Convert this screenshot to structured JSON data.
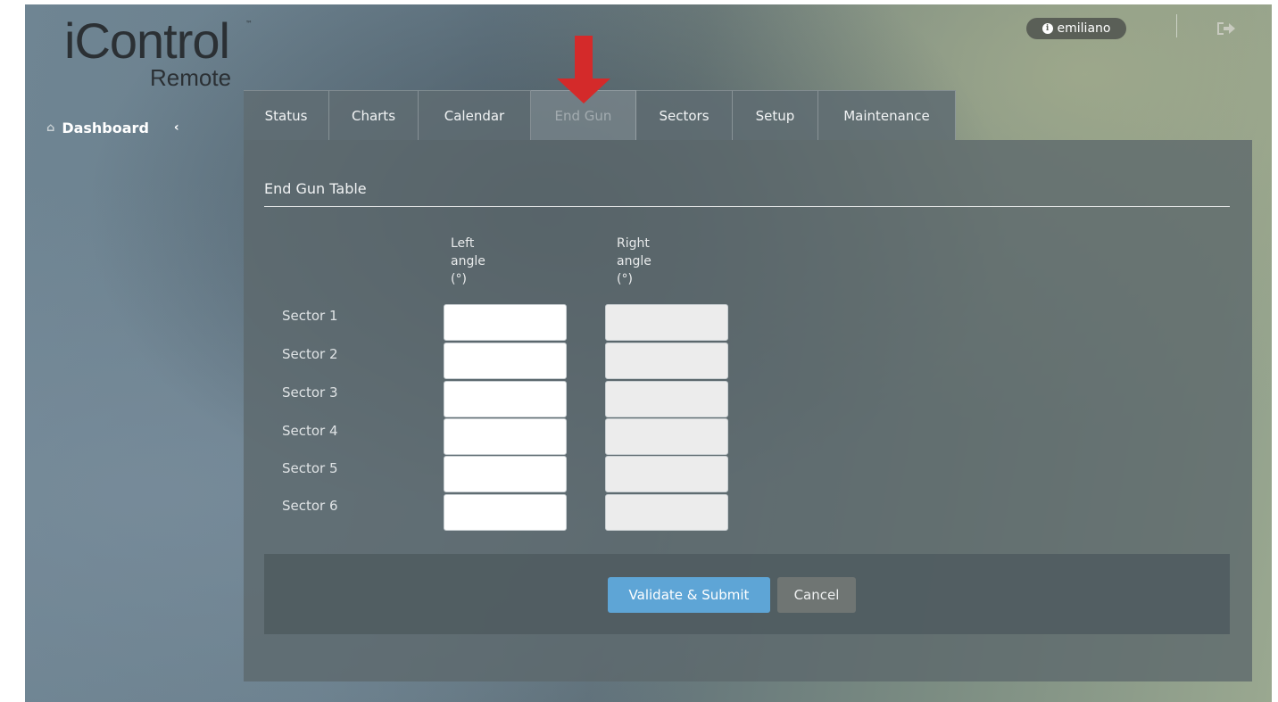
{
  "logo": {
    "main": "iControl",
    "tm": "™",
    "sub": "Remote"
  },
  "sidebar": {
    "dashboard_label": "Dashboard"
  },
  "header": {
    "username": "emiliano"
  },
  "tabs": [
    {
      "label": "Status"
    },
    {
      "label": "Charts"
    },
    {
      "label": "Calendar"
    },
    {
      "label": "End Gun",
      "active": true
    },
    {
      "label": "Sectors"
    },
    {
      "label": "Setup"
    },
    {
      "label": "Maintenance"
    }
  ],
  "end_gun_table": {
    "title": "End Gun Table",
    "left_header": "Left\nangle\n(°)",
    "right_header": "Right\nangle\n(°)",
    "rows": [
      {
        "label": "Sector 1",
        "left": "",
        "right": ""
      },
      {
        "label": "Sector 2",
        "left": "",
        "right": ""
      },
      {
        "label": "Sector 3",
        "left": "",
        "right": ""
      },
      {
        "label": "Sector 4",
        "left": "",
        "right": ""
      },
      {
        "label": "Sector 5",
        "left": "",
        "right": ""
      },
      {
        "label": "Sector 6",
        "left": "",
        "right": ""
      }
    ]
  },
  "actions": {
    "submit_label": "Validate & Submit",
    "cancel_label": "Cancel"
  },
  "colors": {
    "accent": "#5ea5d6",
    "annotation_arrow": "#d42a2a"
  },
  "icons": {
    "home": "home-icon",
    "collapse": "chevron-left-icon",
    "info": "info-icon",
    "logout": "logout-icon",
    "annotation": "red-arrow-down"
  }
}
